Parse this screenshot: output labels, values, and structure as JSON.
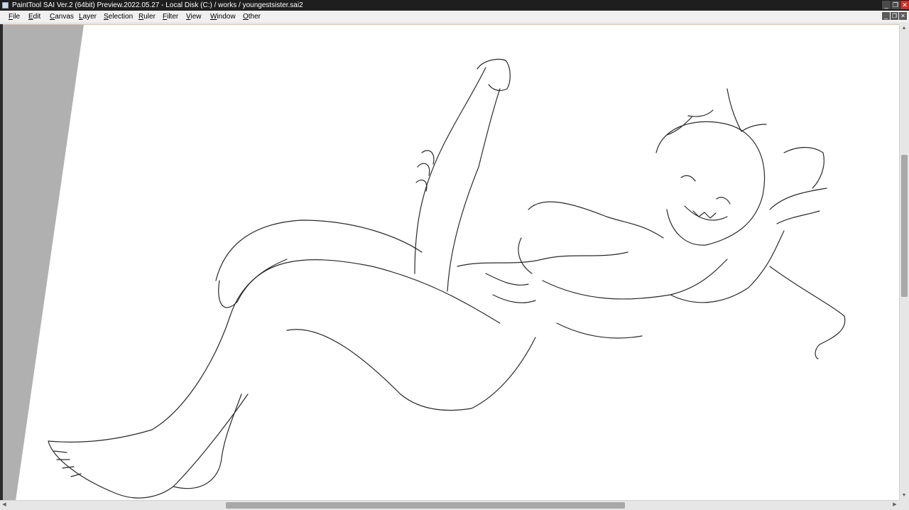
{
  "window": {
    "title": "PaintTool SAI Ver.2 (64bit) Preview.2022.05.27 - Local Disk (C:) / works / youngestsister.sai2",
    "controls": {
      "minimize": "_",
      "restore": "❐",
      "close": "✕"
    }
  },
  "menubar": {
    "items": [
      {
        "key": "F",
        "rest": "ile"
      },
      {
        "key": "E",
        "rest": "dit"
      },
      {
        "key": "C",
        "rest": "anvas"
      },
      {
        "key": "L",
        "rest": "ayer"
      },
      {
        "key": "S",
        "rest": "election"
      },
      {
        "key": "R",
        "rest": "uler"
      },
      {
        "key": "F",
        "rest": "ilter"
      },
      {
        "key": "V",
        "rest": "iew"
      },
      {
        "key": "W",
        "rest": "indow"
      },
      {
        "key": "O",
        "rest": "ther"
      }
    ],
    "document_controls": {
      "minimize": "_",
      "restore": "❐",
      "close": "✕"
    }
  },
  "scrollbars": {
    "up": "▲",
    "down": "▼",
    "left": "◀",
    "right": "▶",
    "vertical_position": 0.3,
    "horizontal_position": 0.42
  },
  "colors": {
    "titlebar": "#1e1e1e",
    "canvas": "#ffffff",
    "offcanvas": "#b0b0b0",
    "sketch_line": "#2a2a2a"
  }
}
